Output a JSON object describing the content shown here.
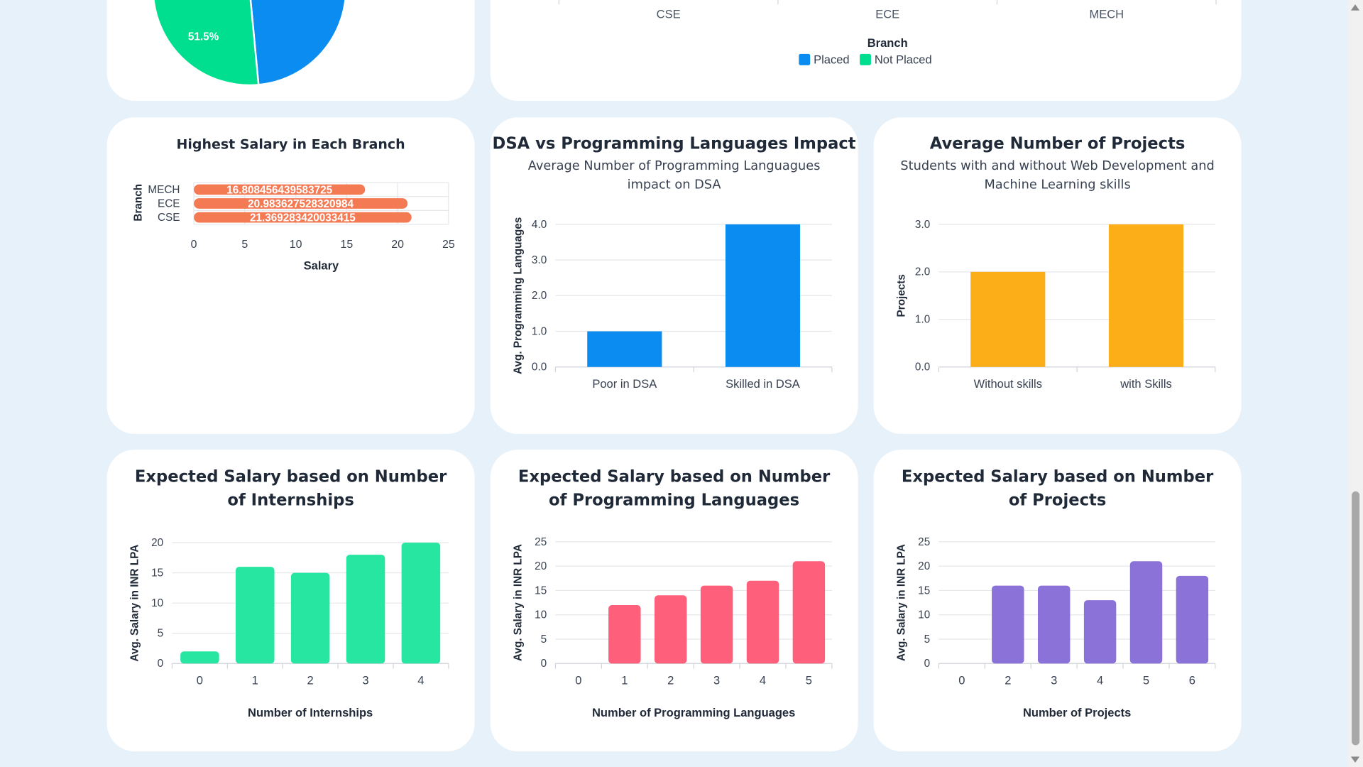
{
  "colors": {
    "background": "#e7f1f9",
    "placed": "#0a8cf0",
    "not_placed": "#00df8f",
    "salary_bar": "#f47a54",
    "dsa_bar": "#0a8cf0",
    "projects_bar": "#fbae17",
    "internships_bar": "#26e6a1",
    "languages_bar": "#fe5f7a",
    "projects_salary_bar": "#8b72d8"
  },
  "cards": {
    "pie": {
      "slice_label": "51.5%",
      "chart_data": {
        "type": "pie",
        "labels": [
          "Placed",
          "Not Placed"
        ],
        "values": [
          48.5,
          51.5
        ]
      }
    },
    "placement_branch": {
      "legend_title": "Branch",
      "legend": [
        "Placed",
        "Not Placed"
      ],
      "chart_data": {
        "type": "bar",
        "categories": [
          "CSE",
          "ECE",
          "MECH"
        ],
        "xlabel": "Branch",
        "legend_position": "bottom"
      }
    },
    "highest_salary": {
      "title": "Highest Salary in Each Branch",
      "chart_data": {
        "type": "bar",
        "orientation": "horizontal",
        "categories": [
          "MECH",
          "ECE",
          "CSE"
        ],
        "values": [
          16.808456439583725,
          20.983627528320984,
          21.369283420033415
        ],
        "value_labels": [
          "16.808456439583725",
          "20.983627528320984",
          "21.369283420033415"
        ],
        "xlabel": "Salary",
        "ylabel": "Branch",
        "xlim": [
          0,
          25
        ],
        "xticks": [
          "0",
          "5",
          "10",
          "15",
          "20",
          "25"
        ]
      }
    },
    "dsa": {
      "title": "DSA vs Programming Languages Impact",
      "subtitle": "Average Number of Programming Languagues impact on DSA",
      "chart_data": {
        "type": "bar",
        "categories": [
          "Poor in DSA",
          "Skilled in DSA"
        ],
        "values": [
          1.0,
          4.0
        ],
        "ylabel": "Avg. Programming Languages",
        "ylim": [
          0,
          4
        ],
        "yticks": [
          "0.0",
          "1.0",
          "2.0",
          "3.0",
          "4.0"
        ]
      }
    },
    "projects_avg": {
      "title": "Average Number of Projects",
      "subtitle": "Students with and without Web Development and Machine Learning skills",
      "chart_data": {
        "type": "bar",
        "categories": [
          "Without skills",
          "with Skills"
        ],
        "values": [
          2.0,
          3.0
        ],
        "ylabel": "Projects",
        "ylim": [
          0,
          3
        ],
        "yticks": [
          "0.0",
          "1.0",
          "2.0",
          "3.0"
        ]
      }
    },
    "internships": {
      "title": "Expected Salary based on Number of Internships",
      "chart_data": {
        "type": "bar",
        "categories": [
          "0",
          "1",
          "2",
          "3",
          "4"
        ],
        "values": [
          2,
          16,
          15,
          18,
          20
        ],
        "xlabel": "Number of Internships",
        "ylabel": "Avg. Salary in INR LPA",
        "ylim": [
          0,
          20
        ],
        "yticks": [
          "0",
          "5",
          "10",
          "15",
          "20"
        ]
      }
    },
    "languages": {
      "title": "Expected Salary based on Number of Programming Languages",
      "chart_data": {
        "type": "bar",
        "categories": [
          "0",
          "1",
          "2",
          "3",
          "4",
          "5"
        ],
        "values": [
          0,
          12,
          14,
          16,
          17,
          21
        ],
        "xlabel": "Number of Programming Languages",
        "ylabel": "Avg. Salary in INR LPA",
        "ylim": [
          0,
          25
        ],
        "yticks": [
          "0",
          "5",
          "10",
          "15",
          "20",
          "25"
        ]
      }
    },
    "projects_salary": {
      "title": "Expected Salary based on Number of Projects",
      "chart_data": {
        "type": "bar",
        "categories": [
          "0",
          "2",
          "3",
          "4",
          "5",
          "6"
        ],
        "values": [
          0,
          16,
          16,
          13,
          21,
          18
        ],
        "xlabel": "Number of Projects",
        "ylabel": "Avg. Salary in INR LPA",
        "ylim": [
          0,
          25
        ],
        "yticks": [
          "0",
          "5",
          "10",
          "15",
          "20",
          "25"
        ]
      }
    }
  }
}
